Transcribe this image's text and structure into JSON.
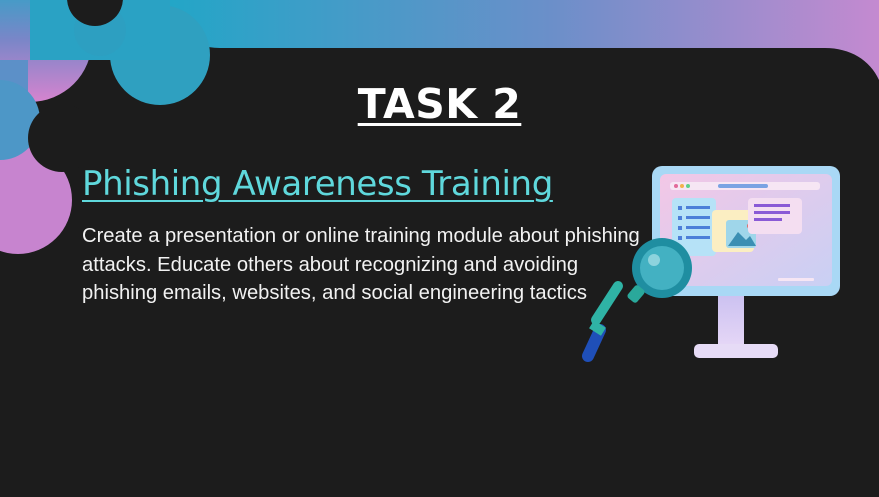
{
  "slide": {
    "title": "TASK 2",
    "subtitle": "Phishing Awareness Training",
    "body": "Create a presentation or online training module about phishing attacks. Educate others about recognizing and avoiding phishing emails, websites, and social engineering tactics"
  },
  "colors": {
    "background": "#1c1c1c",
    "subtitle": "#5fd8dc",
    "gradient_start": "#2fa4c4",
    "gradient_end": "#c48ad0"
  },
  "icons": [
    "decorative-blob-shape",
    "monitor-illustration",
    "magnifying-glass-icon"
  ]
}
